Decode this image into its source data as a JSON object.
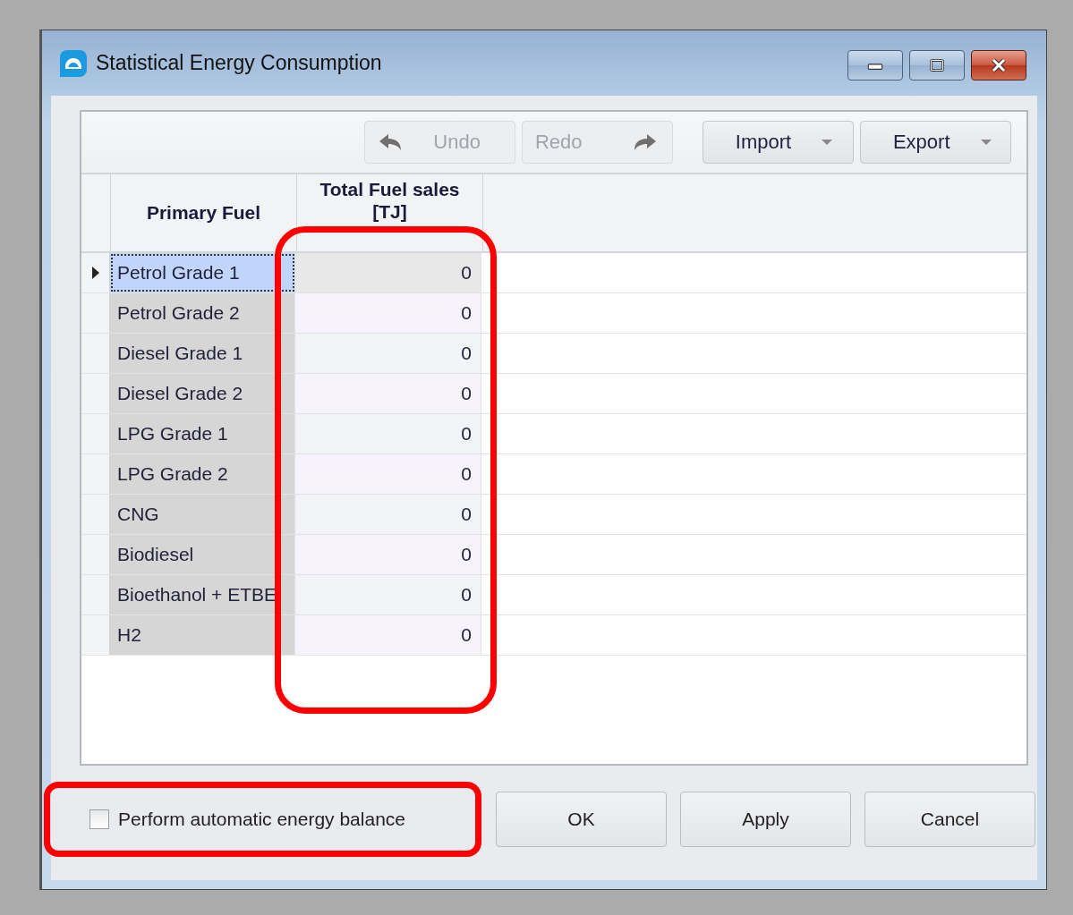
{
  "window": {
    "title": "Statistical Energy Consumption"
  },
  "toolbar": [
    {
      "label": "Undo",
      "kind": "undo",
      "disabled": true
    },
    {
      "label": "Redo",
      "kind": "redo",
      "disabled": true
    },
    {
      "label": "Import",
      "kind": "dropdown",
      "disabled": false
    },
    {
      "label": "Export",
      "kind": "dropdown",
      "disabled": false
    }
  ],
  "table": {
    "columns": [
      {
        "label": "Primary Fuel"
      },
      {
        "label": "Total Fuel sales\n[TJ]",
        "highlighted": true
      }
    ],
    "rows": [
      {
        "fuel": "Petrol Grade 1",
        "value": "0",
        "selected": true
      },
      {
        "fuel": "Petrol Grade 2",
        "value": "0",
        "selected": false
      },
      {
        "fuel": "Diesel Grade 1",
        "value": "0",
        "selected": false
      },
      {
        "fuel": "Diesel Grade 2",
        "value": "0",
        "selected": false
      },
      {
        "fuel": "LPG Grade 1",
        "value": "0",
        "selected": false
      },
      {
        "fuel": "LPG Grade 2",
        "value": "0",
        "selected": false
      },
      {
        "fuel": "CNG",
        "value": "0",
        "selected": false
      },
      {
        "fuel": "Biodiesel",
        "value": "0",
        "selected": false
      },
      {
        "fuel": "Bioethanol + ETBE",
        "value": "0",
        "selected": false
      },
      {
        "fuel": "H2",
        "value": "0",
        "selected": false
      }
    ]
  },
  "checkbox": {
    "label": "Perform automatic energy balance",
    "checked": false,
    "highlighted": true
  },
  "buttons": [
    "OK",
    "Apply",
    "Cancel"
  ]
}
